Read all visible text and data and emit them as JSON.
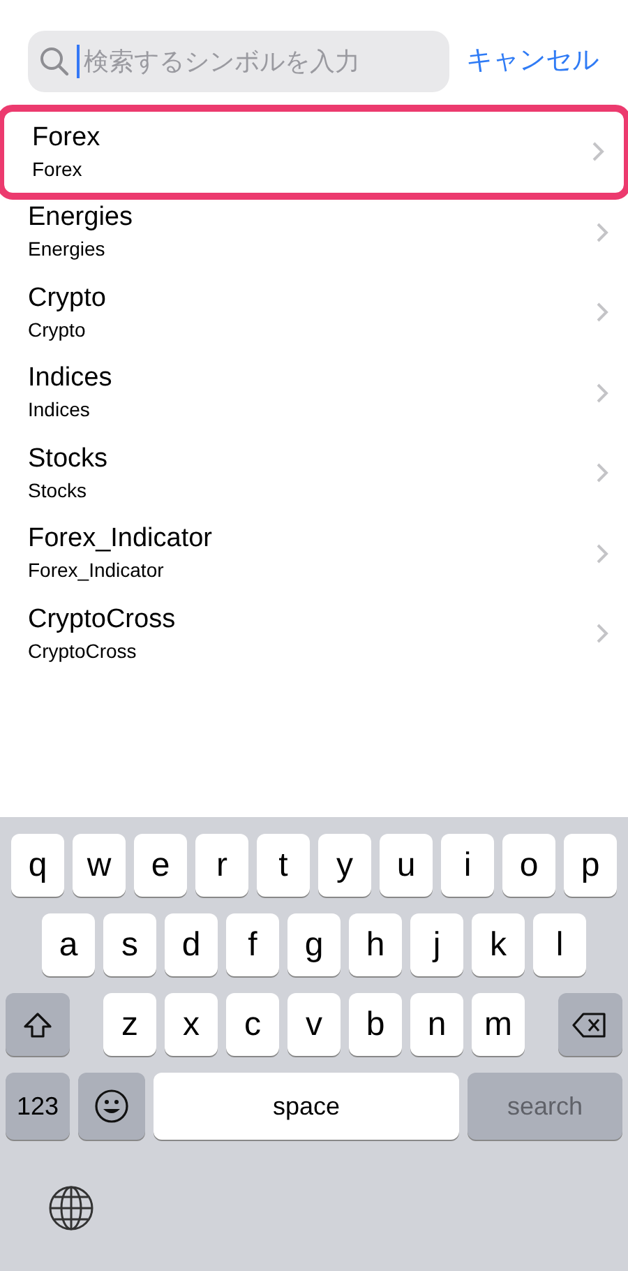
{
  "search": {
    "placeholder": "検索するシンボルを入力",
    "cancel": "キャンセル"
  },
  "groups": [
    {
      "title": "Forex",
      "subtitle": "Forex",
      "highlighted": true
    },
    {
      "title": "Energies",
      "subtitle": "Energies",
      "highlighted": false
    },
    {
      "title": "Crypto",
      "subtitle": "Crypto",
      "highlighted": false
    },
    {
      "title": "Indices",
      "subtitle": "Indices",
      "highlighted": false
    },
    {
      "title": "Stocks",
      "subtitle": "Stocks",
      "highlighted": false
    },
    {
      "title": "Forex_Indicator",
      "subtitle": "Forex_Indicator",
      "highlighted": false
    },
    {
      "title": "CryptoCross",
      "subtitle": "CryptoCross",
      "highlighted": false
    }
  ],
  "keyboard": {
    "rows": [
      [
        "q",
        "w",
        "e",
        "r",
        "t",
        "y",
        "u",
        "i",
        "o",
        "p"
      ],
      [
        "a",
        "s",
        "d",
        "f",
        "g",
        "h",
        "j",
        "k",
        "l"
      ],
      [
        "z",
        "x",
        "c",
        "v",
        "b",
        "n",
        "m"
      ]
    ],
    "numbers_key": "123",
    "space_key": "space",
    "action_key": "search"
  }
}
